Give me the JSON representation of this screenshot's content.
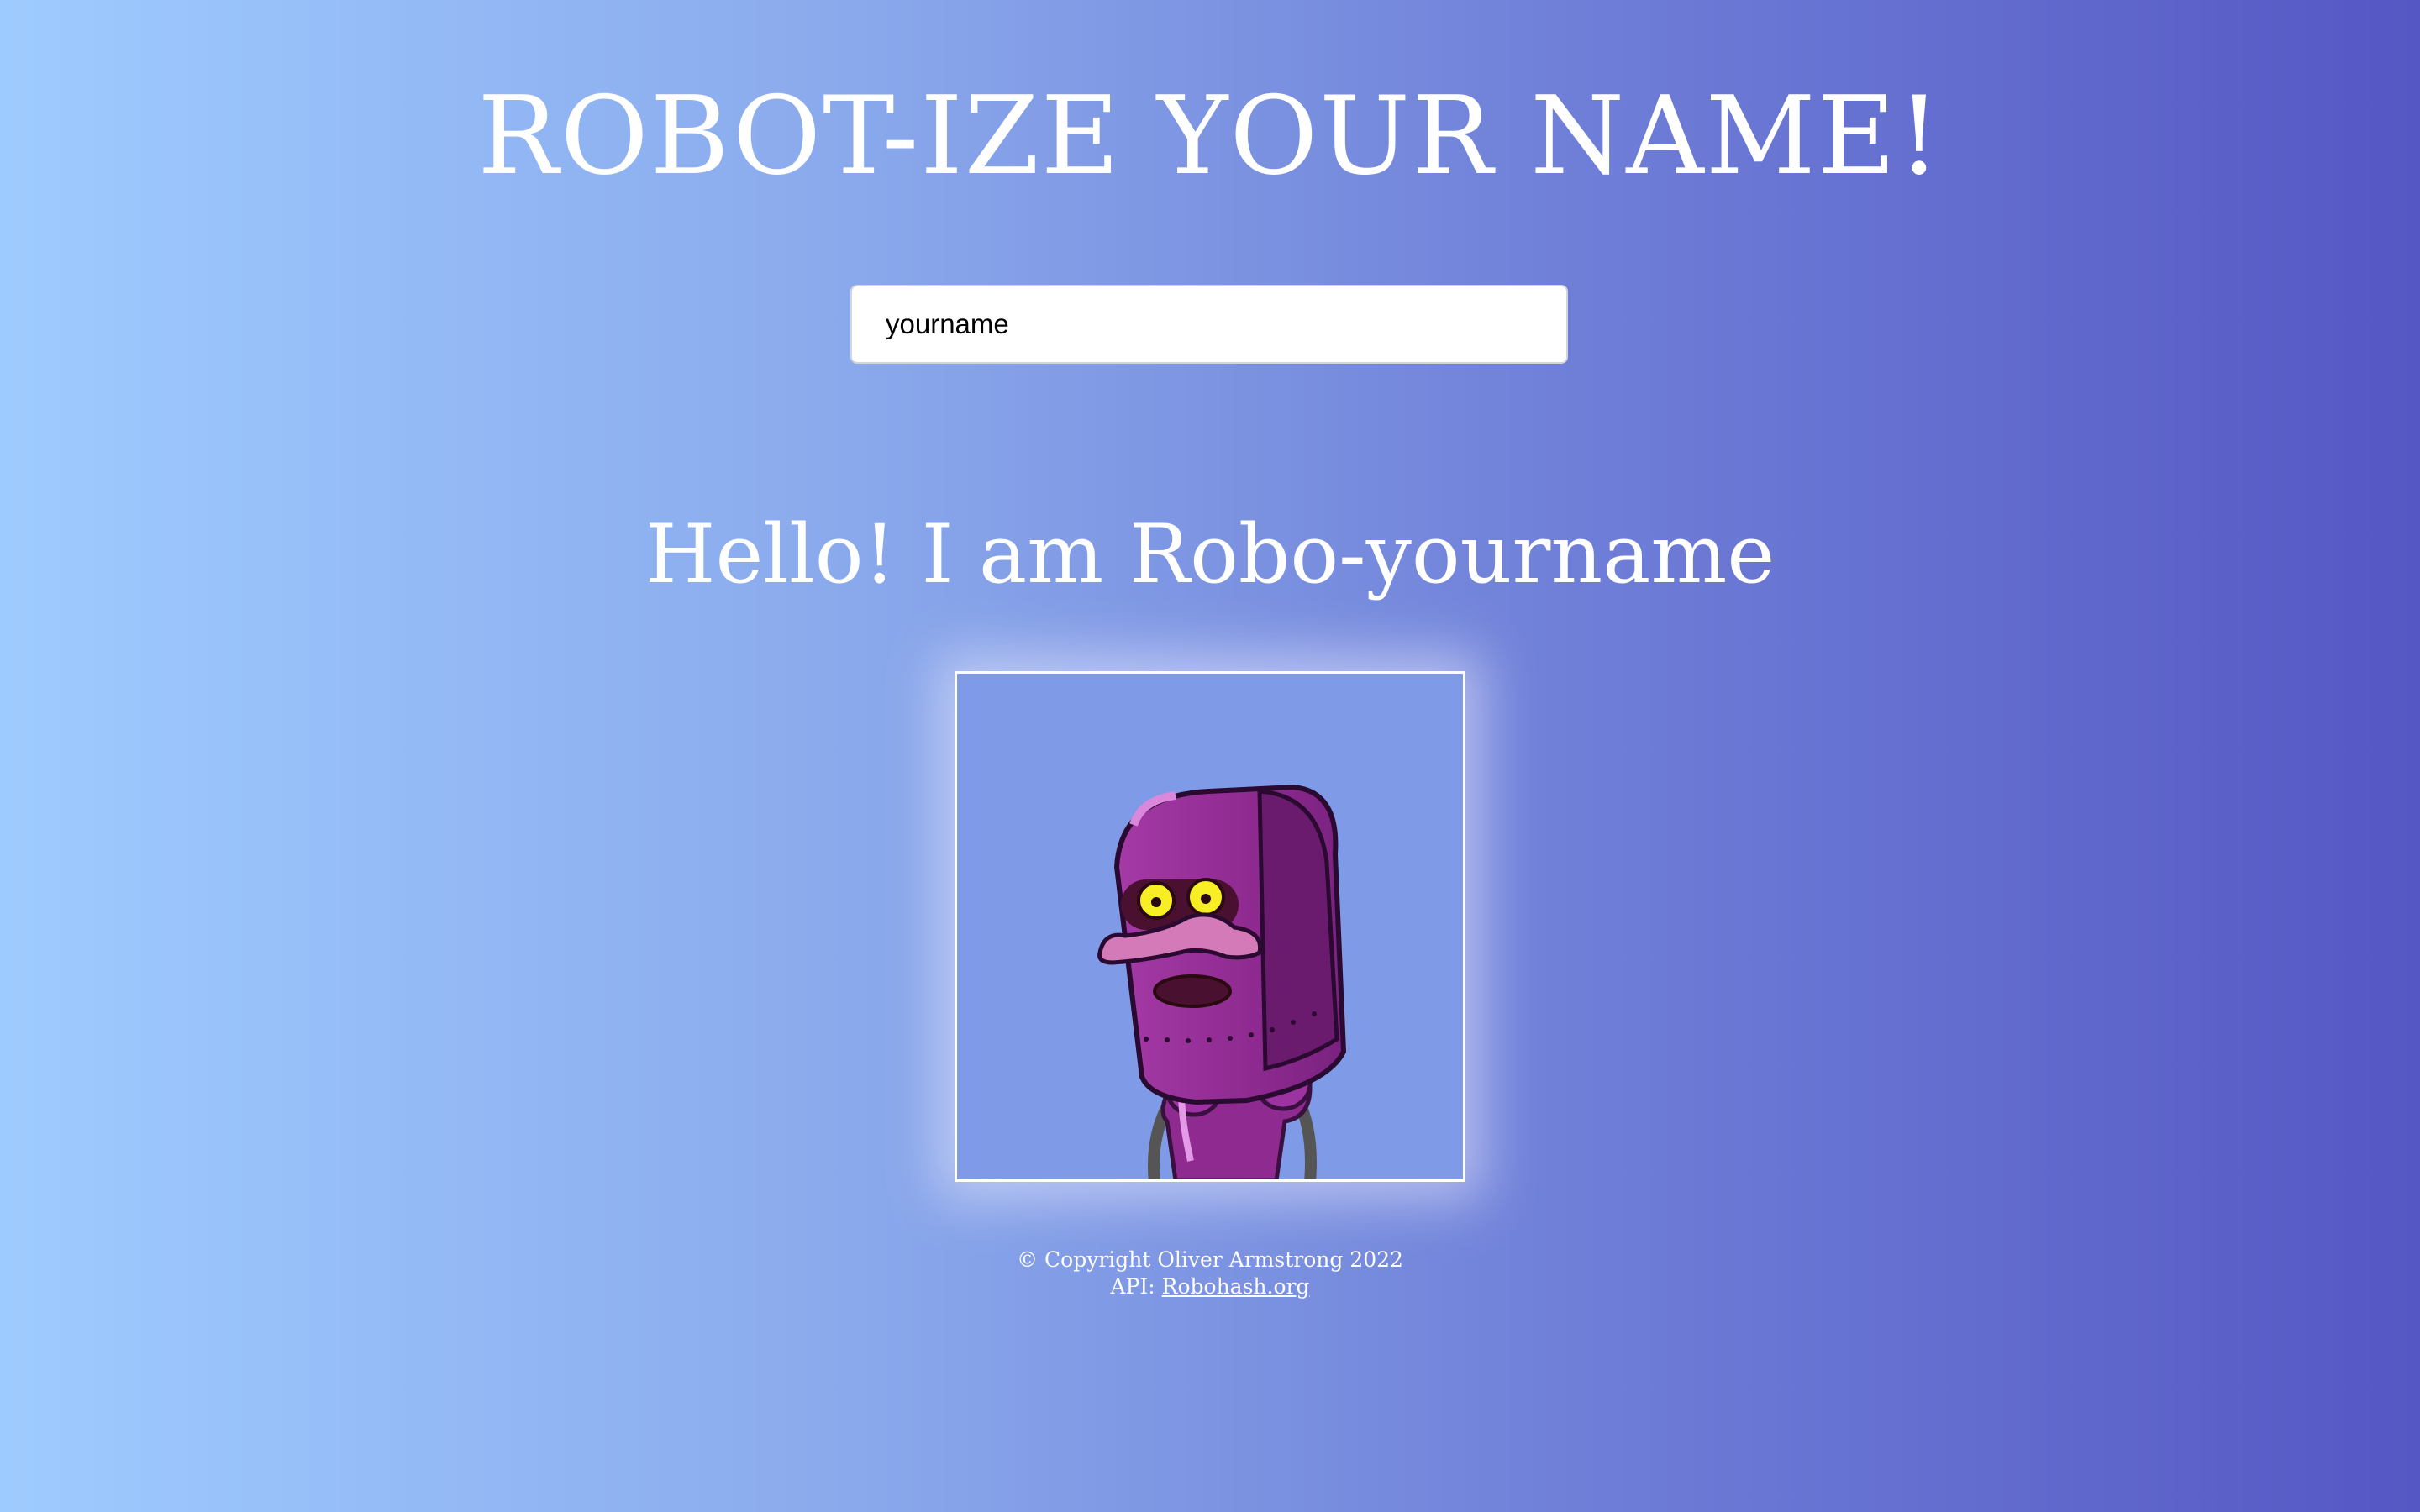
{
  "header": {
    "title": "ROBOT-IZE YOUR NAME!"
  },
  "name_input": {
    "value": "yourname"
  },
  "greeting": {
    "text": "Hello! I am Robo-yourname"
  },
  "robot": {
    "icon": "robot-avatar-image",
    "colors": {
      "background": "#7f9ae6",
      "body": "#8e2a90",
      "body_shadow": "#6a1b6e",
      "eyes": "#f7ef23"
    }
  },
  "footer": {
    "copyright": "© Copyright Oliver Armstrong 2022",
    "api_prefix": "API:",
    "api_link": "Robohash.org"
  }
}
